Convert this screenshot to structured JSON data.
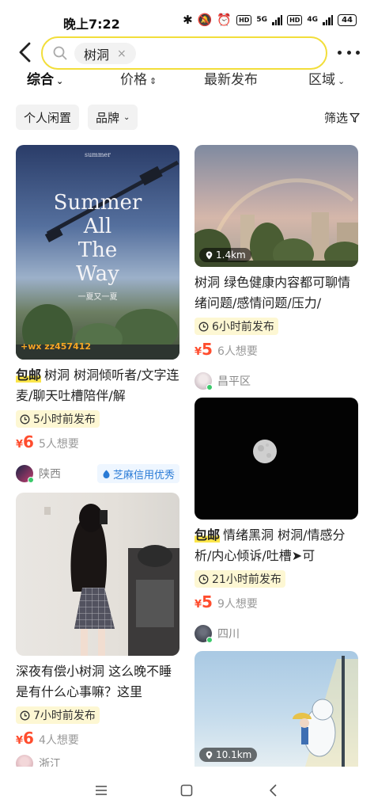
{
  "status_bar": {
    "time": "晚上7:22",
    "signal_1": "5G",
    "signal_2": "4G",
    "battery": "44"
  },
  "search": {
    "tag": "树洞",
    "clear_glyph": "×"
  },
  "sort_tabs": [
    {
      "label": "综合",
      "arrow": "⌄"
    },
    {
      "label": "价格",
      "arrow": "⇕"
    },
    {
      "label": "最新发布",
      "arrow": ""
    },
    {
      "label": "区域",
      "arrow": "⌄"
    }
  ],
  "filters": {
    "chip_personal": "个人闲置",
    "chip_brand": "品牌",
    "chip_brand_arrow": "⌄",
    "filter_label": "筛选"
  },
  "cards": [
    {
      "image_text": {
        "small": "summer",
        "line1": "Summer",
        "line2": "All",
        "line3": "The",
        "line4": "Way",
        "cn": "一夏又一夏",
        "watermark": "+wx zz457412"
      },
      "baoyou": "包邮",
      "title": "树洞 树洞倾听者/文字连麦/聊天吐槽陪伴/解",
      "time": "5小时前发布",
      "currency": "¥",
      "price": "6",
      "wants": "5人想要",
      "location": "陕西",
      "credit": "芝麻信用优秀"
    },
    {
      "distance": "1.4km",
      "title": "树洞 绿色健康内容都可聊情绪问题/感情问题/压力/",
      "time": "6小时前发布",
      "currency": "¥",
      "price": "5",
      "wants": "6人想要",
      "location": "昌平区"
    },
    {
      "baoyou": "包邮",
      "title": "情绪黑洞 树洞/情感分析/内心倾诉/吐槽➤可",
      "time": "21小时前发布",
      "currency": "¥",
      "price": "5",
      "wants": "9人想要",
      "location": "四川"
    },
    {
      "title": "深夜有偿小树洞 这么晚不睡是有什么心事嘛？这里",
      "time": "7小时前发布",
      "currency": "¥",
      "price": "6",
      "wants": "4人想要",
      "location": "浙江"
    },
    {
      "distance": "10.1km"
    }
  ],
  "colors": {
    "accent_yellow": "#f2de3a",
    "price_red": "#ff4d2e",
    "credit_blue": "#2a7bd6",
    "online_green": "#3bc96b"
  }
}
